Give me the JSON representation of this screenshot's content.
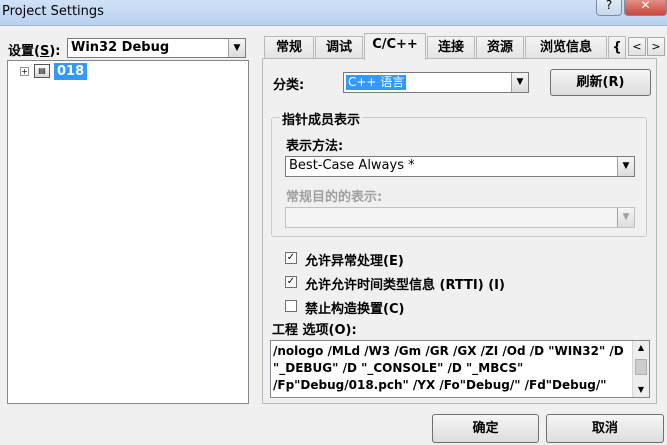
{
  "window": {
    "title": "Project Settings",
    "help_glyph": "?",
    "close_glyph": "✕"
  },
  "left": {
    "settings_label": "设置(",
    "settings_hotkey": "S",
    "settings_label_end": "):",
    "settings_value": "Win32 Debug",
    "tree": {
      "expand_glyph": "+",
      "project_label": "018"
    }
  },
  "tabs": [
    {
      "label": "常规"
    },
    {
      "label": "调试"
    },
    {
      "label": "C/C++"
    },
    {
      "label": "连接"
    },
    {
      "label": "资源"
    },
    {
      "label": "浏览信息"
    },
    {
      "label": "{"
    }
  ],
  "tab_scroll": {
    "left": "<",
    "right": ">"
  },
  "panel": {
    "category_label": "分类:",
    "category_value": "C++ 语言",
    "reset_button": "刷新(R)",
    "group_title": "指针成员表示",
    "method_label": "表示方法:",
    "method_value": "Best-Case Always *",
    "general_label": "常规目的的表示:",
    "general_value": "",
    "checks": [
      {
        "label": "允许异常处理(E)",
        "checked": true
      },
      {
        "label": "允许允许时间类型信息 (RTTI) (I)",
        "checked": true
      },
      {
        "label": "禁止构造换置(C)",
        "checked": false
      }
    ],
    "options_label": "工程 选项(O):",
    "options_text": "/nologo /MLd /W3 /Gm /GR /GX /ZI /Od /D \"WIN32\" /D \"_DEBUG\" /D \"_CONSOLE\" /D \"_MBCS\" /Fp\"Debug/018.pch\" /YX /Fo\"Debug/\" /Fd\"Debug/\" /FD"
  },
  "footer": {
    "ok_button": "确定",
    "cancel_button": "取消"
  },
  "colors": {
    "selection": "#3399ff",
    "title_bar": "#cfe1f6"
  }
}
